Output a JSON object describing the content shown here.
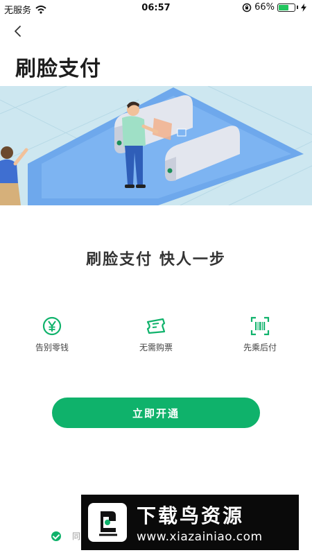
{
  "status_bar": {
    "carrier": "无服务",
    "time": "06:57",
    "battery_percent": "66%",
    "battery_level": 0.66
  },
  "header": {
    "back_icon": "chevron-left-icon",
    "title": "刷脸支付"
  },
  "hero": {
    "illustration": "face-pay-turnstile-illustration"
  },
  "slogan": "刷脸支付  快人一步",
  "features": [
    {
      "icon": "yen-coin-icon",
      "label": "告别零钱"
    },
    {
      "icon": "ticket-icon",
      "label": "无需购票"
    },
    {
      "icon": "scan-barcode-icon",
      "label": "先乘后付"
    }
  ],
  "actions": {
    "open_label": "立即开通"
  },
  "agreement": {
    "text": "同"
  },
  "watermark": {
    "title": "下载鸟资源",
    "url": "www.xiazainiao.com"
  },
  "colors": {
    "brand_green": "#0fb26b",
    "hero_bg": "#cde7f0",
    "platform_blue": "#6ea8ec"
  }
}
